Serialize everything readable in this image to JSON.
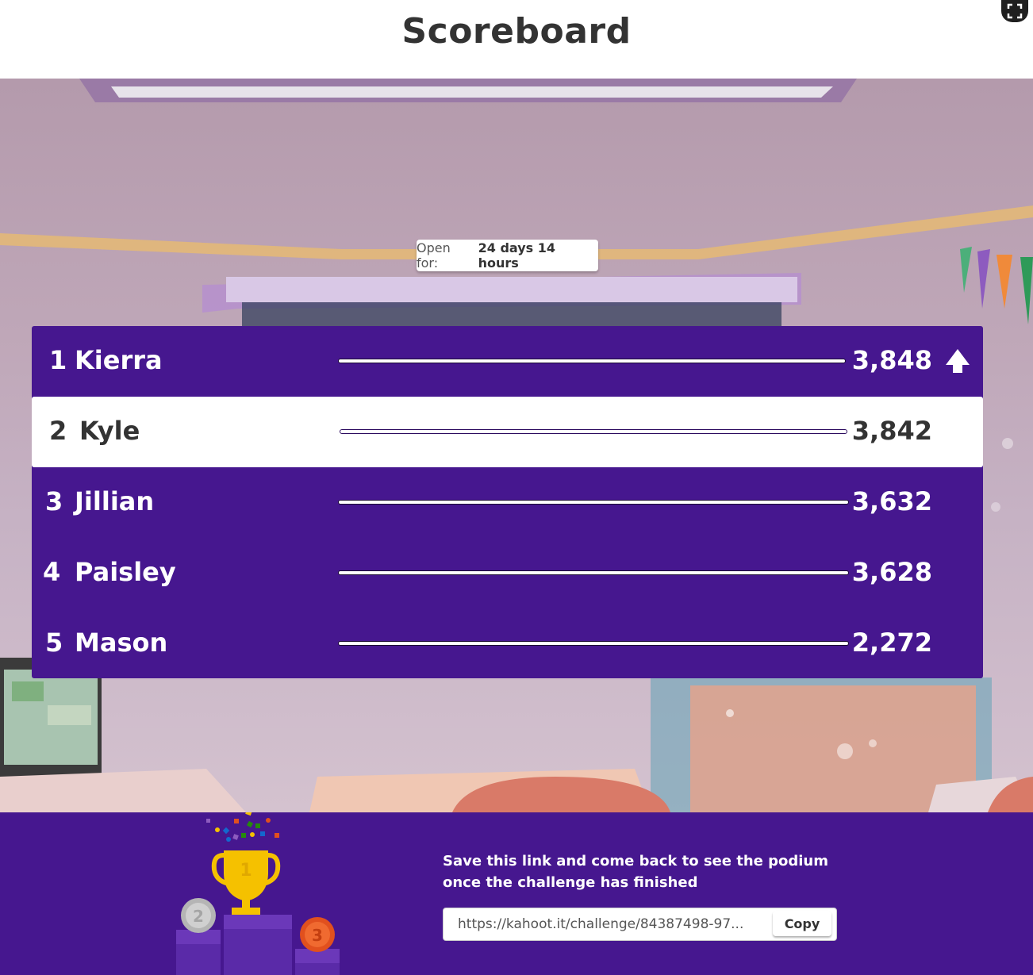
{
  "header": {
    "title": "Scoreboard"
  },
  "timer": {
    "label": "Open for:",
    "value": "24 days 14 hours"
  },
  "scoreboard": {
    "rows": [
      {
        "rank": "1",
        "name": "Kierra",
        "score": "3,848",
        "up": true
      },
      {
        "rank": "2",
        "name": "Kyle",
        "score": "3,842",
        "highlighted": true
      },
      {
        "rank": "3",
        "name": "Jillian",
        "score": "3,632"
      },
      {
        "rank": "4",
        "name": "Paisley",
        "score": "3,628"
      },
      {
        "rank": "5",
        "name": "Mason",
        "score": "2,272"
      }
    ]
  },
  "footer": {
    "message": "Save this link and come back to see the podium once the challenge has finished",
    "link": "https://kahoot.it/challenge/84387498-97...",
    "copy_label": "Copy"
  },
  "podium": {
    "first": "1",
    "second": "2",
    "third": "3"
  },
  "colors": {
    "purple": "#46178f",
    "white": "#ffffff",
    "gold": "#f5c100",
    "silver": "#b5b5b5",
    "bronze": "#e1501e"
  }
}
